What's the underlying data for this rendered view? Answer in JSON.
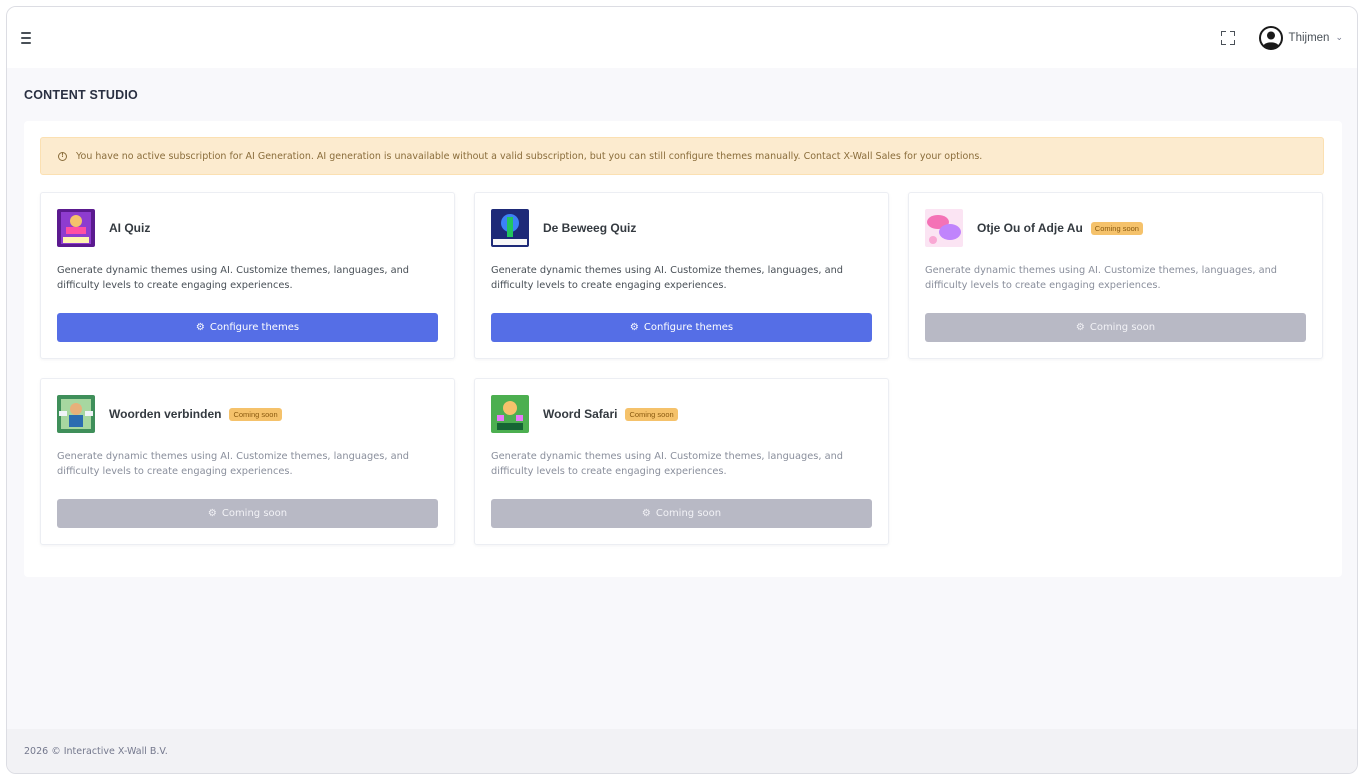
{
  "topbar": {
    "menu_icon": "hamburger-menu-icon",
    "fullscreen_icon": "fullscreen-icon",
    "user_avatar_icon": "user-circle-icon",
    "user_name": "Thijmen",
    "user_chevron": "⌄"
  },
  "page": {
    "title": "CONTENT STUDIO"
  },
  "alert": {
    "icon": "ⓘ",
    "text": "You have no active subscription for AI Generation. AI generation is unavailable without a valid subscription, but you can still configure themes manually. Contact X-Wall Sales for your options."
  },
  "cards": [
    {
      "title": "AI Quiz",
      "badge": "",
      "description": "Generate dynamic themes using AI. Customize themes, languages, and difficulty levels to create engaging experiences.",
      "button_icon": "⚙",
      "button_label": "Configure themes",
      "enabled": true,
      "thumb_colors": [
        "#7b2cbf",
        "#c77dff"
      ]
    },
    {
      "title": "De Beweeg Quiz",
      "badge": "",
      "description": "Generate dynamic themes using AI. Customize themes, languages, and difficulty levels to create engaging experiences.",
      "button_icon": "⚙",
      "button_label": "Configure themes",
      "enabled": true,
      "thumb_colors": [
        "#1e3a8a",
        "#60a5fa"
      ]
    },
    {
      "title": "Otje Ou of Adje Au",
      "badge": "Coming soon",
      "description": "Generate dynamic themes using AI. Customize themes, languages, and difficulty levels to create engaging experiences.",
      "button_icon": "⚙",
      "button_label": "Coming soon",
      "enabled": false,
      "thumb_colors": [
        "#f472b6",
        "#c084fc"
      ]
    },
    {
      "title": "Woorden verbinden",
      "badge": "Coming soon",
      "description": "Generate dynamic themes using AI. Customize themes, languages, and difficulty levels to create engaging experiences.",
      "button_icon": "⚙",
      "button_label": "Coming soon",
      "enabled": false,
      "thumb_colors": [
        "#4ade80",
        "#14532d"
      ]
    },
    {
      "title": "Woord Safari",
      "badge": "Coming soon",
      "description": "Generate dynamic themes using AI. Customize themes, languages, and difficulty levels to create engaging experiences.",
      "button_icon": "⚙",
      "button_label": "Coming soon",
      "enabled": false,
      "thumb_colors": [
        "#22c55e",
        "#fbbf24"
      ]
    }
  ],
  "footer": {
    "text": "2026 © Interactive X-Wall B.V."
  },
  "colors": {
    "primary": "#556ee6",
    "disabled": "#b8b9c5",
    "badge": "#f5c26b",
    "alert_bg": "#fcebcf"
  }
}
